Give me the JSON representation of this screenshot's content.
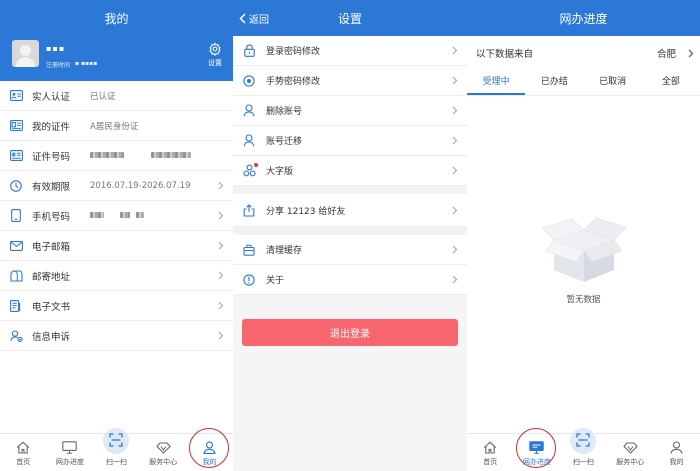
{
  "profile_page": {
    "title": "我的",
    "username_masked": "▪▪▪",
    "reg_label": "注册时间",
    "reg_value_masked": "▪ ▪▪▪▪",
    "settings_label": "设置",
    "rows": [
      {
        "label": "实人认证",
        "value": "已认证",
        "chevron": false,
        "icon": "id-card-icon"
      },
      {
        "label": "我的证件",
        "value": "A居民身份证",
        "chevron": false,
        "icon": "document-icon"
      },
      {
        "label": "证件号码",
        "value": "",
        "chevron": false,
        "icon": "id-number-icon"
      },
      {
        "label": "有效期限",
        "value": "2016.07.19-2026.07.19",
        "chevron": true,
        "icon": "clock-icon"
      },
      {
        "label": "手机号码",
        "value": "",
        "chevron": true,
        "icon": "phone-icon"
      },
      {
        "label": "电子邮箱",
        "value": "",
        "chevron": true,
        "icon": "mail-icon"
      },
      {
        "label": "邮寄地址",
        "value": "",
        "chevron": true,
        "icon": "mailbox-icon"
      },
      {
        "label": "电子文书",
        "value": "",
        "chevron": true,
        "icon": "file-icon"
      },
      {
        "label": "信息申诉",
        "value": "",
        "chevron": true,
        "icon": "appeal-icon"
      }
    ],
    "tabbar": [
      {
        "label": "首页",
        "icon": "home-icon"
      },
      {
        "label": "网办进度",
        "icon": "monitor-icon"
      },
      {
        "label": "扫一扫",
        "icon": "scan-icon"
      },
      {
        "label": "服务中心",
        "icon": "diamond-icon"
      },
      {
        "label": "我的",
        "icon": "person-icon",
        "active": true
      }
    ]
  },
  "settings_page": {
    "back_label": "返回",
    "title": "设置",
    "group1": [
      {
        "label": "登录密码修改",
        "icon": "lock-icon"
      },
      {
        "label": "手势密码修改",
        "icon": "gesture-icon"
      },
      {
        "label": "删除账号",
        "icon": "user-remove-icon"
      },
      {
        "label": "账号迁移",
        "icon": "user-transfer-icon"
      },
      {
        "label": "大字版",
        "icon": "font-size-icon"
      }
    ],
    "group2": [
      {
        "label": "分享 12123 给好友",
        "icon": "share-icon"
      }
    ],
    "group3": [
      {
        "label": "清理缓存",
        "icon": "cache-icon"
      },
      {
        "label": "关于",
        "icon": "info-icon"
      }
    ],
    "logout_label": "退出登录"
  },
  "progress_page": {
    "title": "网办进度",
    "source_label": "以下数据来自",
    "city": "合肥",
    "tabs": [
      {
        "label": "受理中",
        "active": true
      },
      {
        "label": "已办结"
      },
      {
        "label": "已取消"
      },
      {
        "label": "全部"
      }
    ],
    "empty_text": "暂无数据",
    "tabbar": [
      {
        "label": "首页",
        "icon": "home-icon"
      },
      {
        "label": "网办进度",
        "icon": "monitor-icon",
        "active": true
      },
      {
        "label": "扫一扫",
        "icon": "scan-icon"
      },
      {
        "label": "服务中心",
        "icon": "diamond-icon"
      },
      {
        "label": "我的",
        "icon": "person-icon"
      }
    ]
  },
  "colors": {
    "brand_blue": "#2b78d6",
    "logout_red": "#f7666e",
    "highlight_ring": "#d9282f"
  }
}
